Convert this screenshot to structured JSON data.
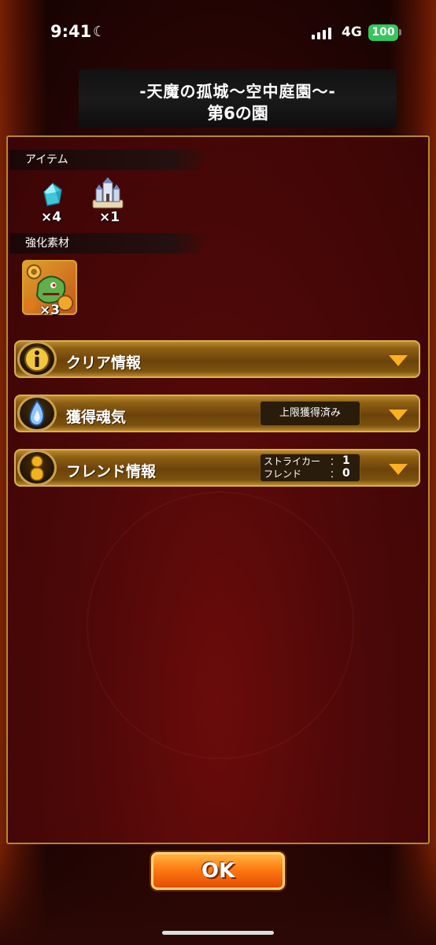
{
  "status_bar": {
    "time": "9:41",
    "network": "4G",
    "battery": "100"
  },
  "title": {
    "line1": "-天魔の孤城～空中庭園～-",
    "line2": "第6の園"
  },
  "items_section": {
    "header": "アイテム",
    "items": [
      {
        "icon": "crystal-icon",
        "qty": "×4"
      },
      {
        "icon": "castle-icon",
        "qty": "×1"
      }
    ]
  },
  "materials_section": {
    "header": "強化素材",
    "items": [
      {
        "icon": "monster-icon",
        "qty": "×3"
      }
    ]
  },
  "rows": {
    "clear_info": {
      "label": "クリア情報",
      "icon": "info-icon"
    },
    "soul": {
      "label": "獲得魂気",
      "icon": "flame-icon",
      "badge": "上限獲得済み"
    },
    "friend": {
      "label": "フレンド情報",
      "icon": "friend-icon",
      "striker_label": "ストライカー",
      "striker_value": "1",
      "friend_label": "フレンド",
      "friend_value": "0",
      "separator": "："
    }
  },
  "ok_button": "OK",
  "colors": {
    "accent_gold": "#d9b050",
    "arrow": "#ffb020",
    "ok_orange": "#ff7a12",
    "battery_green": "#34c759"
  }
}
